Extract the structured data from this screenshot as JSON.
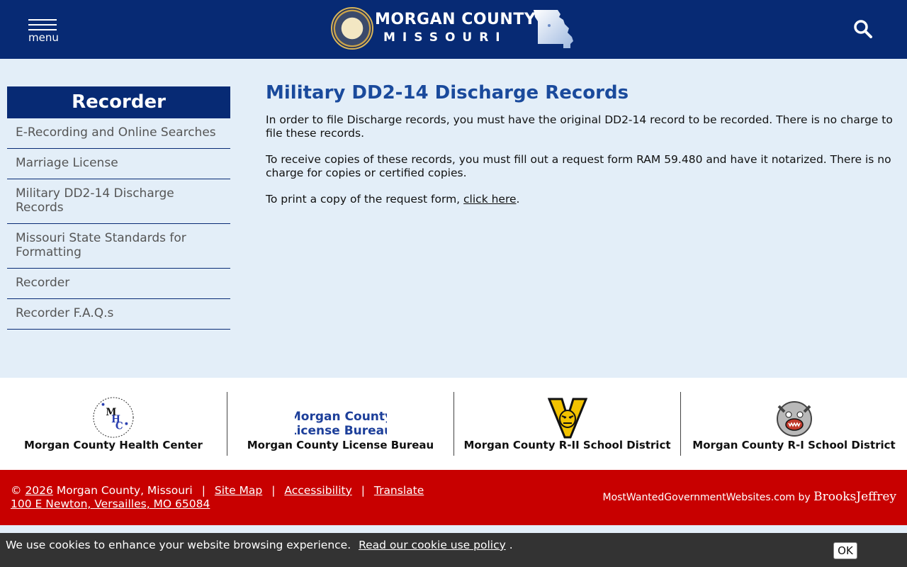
{
  "header": {
    "menu_label": "menu",
    "logo_line1": "MORGAN COUNTY",
    "logo_line2": "MISSOURI",
    "brand_color": "#072a74"
  },
  "sidebar": {
    "title": "Recorder",
    "items": [
      {
        "label": "E-Recording and Online Searches"
      },
      {
        "label": "Marriage License"
      },
      {
        "label": "Military DD2-14 Discharge Records"
      },
      {
        "label": "Missouri State Standards for Formatting"
      },
      {
        "label": "Recorder"
      },
      {
        "label": "Recorder F.A.Q.s"
      }
    ]
  },
  "main": {
    "title": "Military DD2-14 Discharge Records",
    "para1": "In order to file Discharge records, you must have the original DD2-14 record to be recorded. There is no charge to file these records.",
    "para2": "To receive copies of these records, you must fill out a request form RAM 59.480 and have it notarized. There is no charge for copies or certified copies.",
    "para3_prefix": "To print a copy of the request form, ",
    "para3_link": "click here",
    "para3_suffix": "."
  },
  "partners": [
    {
      "name": "Morgan County Health Center",
      "logo_icon": "health-center-logo"
    },
    {
      "name": "Morgan County License Bureau",
      "logo_text": "Morgan County\nLicense Bureau",
      "logo_icon": "license-bureau-logo"
    },
    {
      "name": "Morgan County R-II School District",
      "logo_icon": "tiger-v-logo"
    },
    {
      "name": "Morgan County R-I School District",
      "logo_icon": "bulldog-logo"
    }
  ],
  "footer": {
    "copyright_symbol": "©",
    "year": "2026",
    "org": " Morgan County, Missouri",
    "sitemap": "Site Map",
    "accessibility": "Accessibility",
    "translate": "Translate",
    "address": "100 E Newton, Versailles, MO 65084",
    "credit_site": "MostWantedGovernmentWebsites.com by ",
    "credit_company": "BrooksJeffrey",
    "color": "#c80000"
  },
  "cookie": {
    "text": "We use cookies to enhance your website browsing experience.",
    "link": "Read our cookie use policy",
    "suffix": " .",
    "ok": "OK"
  }
}
